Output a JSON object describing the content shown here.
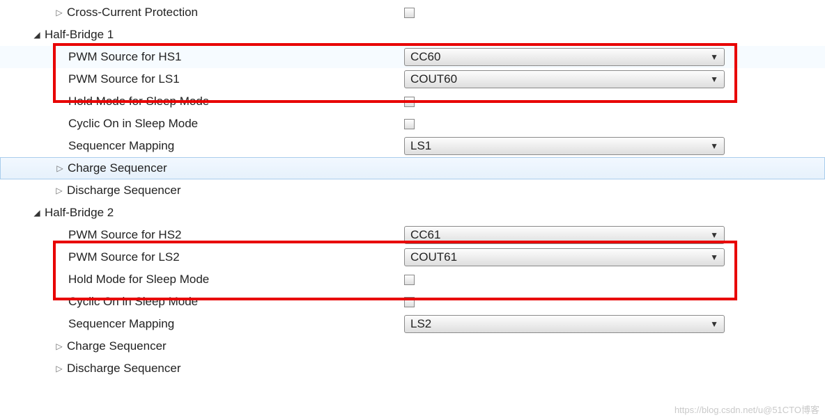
{
  "rows": {
    "crossCurrent": {
      "label": "Cross-Current Protection",
      "indent": 78
    },
    "halfBridge1": {
      "label": "Half-Bridge 1",
      "indent": 46
    },
    "hb1_hs": {
      "label": "PWM Source for HS1",
      "value": "CC60",
      "indent": 98
    },
    "hb1_ls": {
      "label": "PWM Source for LS1",
      "value": "COUT60",
      "indent": 98
    },
    "hb1_hold": {
      "label": "Hold Mode for Sleep Mode",
      "indent": 98
    },
    "hb1_cyclic": {
      "label": "Cyclic On in Sleep Mode",
      "indent": 98
    },
    "hb1_seqmap": {
      "label": "Sequencer Mapping",
      "value": "LS1",
      "indent": 98
    },
    "hb1_charge": {
      "label": "Charge Sequencer",
      "indent": 78
    },
    "hb1_discharge": {
      "label": "Discharge Sequencer",
      "indent": 78
    },
    "halfBridge2": {
      "label": "Half-Bridge 2",
      "indent": 46
    },
    "hb2_hs": {
      "label": "PWM Source for HS2",
      "value": "CC61",
      "indent": 98
    },
    "hb2_ls": {
      "label": "PWM Source for LS2",
      "value": "COUT61",
      "indent": 98
    },
    "hb2_hold": {
      "label": "Hold Mode for Sleep Mode",
      "indent": 98
    },
    "hb2_cyclic": {
      "label": "Cyclic On in Sleep Mode",
      "indent": 98
    },
    "hb2_seqmap": {
      "label": "Sequencer Mapping",
      "value": "LS2",
      "indent": 98
    },
    "hb2_charge": {
      "label": "Charge Sequencer",
      "indent": 78
    },
    "hb2_discharge": {
      "label": "Discharge Sequencer",
      "indent": 78
    }
  },
  "watermark": "https://blog.csdn.net/u@51CTO博客"
}
